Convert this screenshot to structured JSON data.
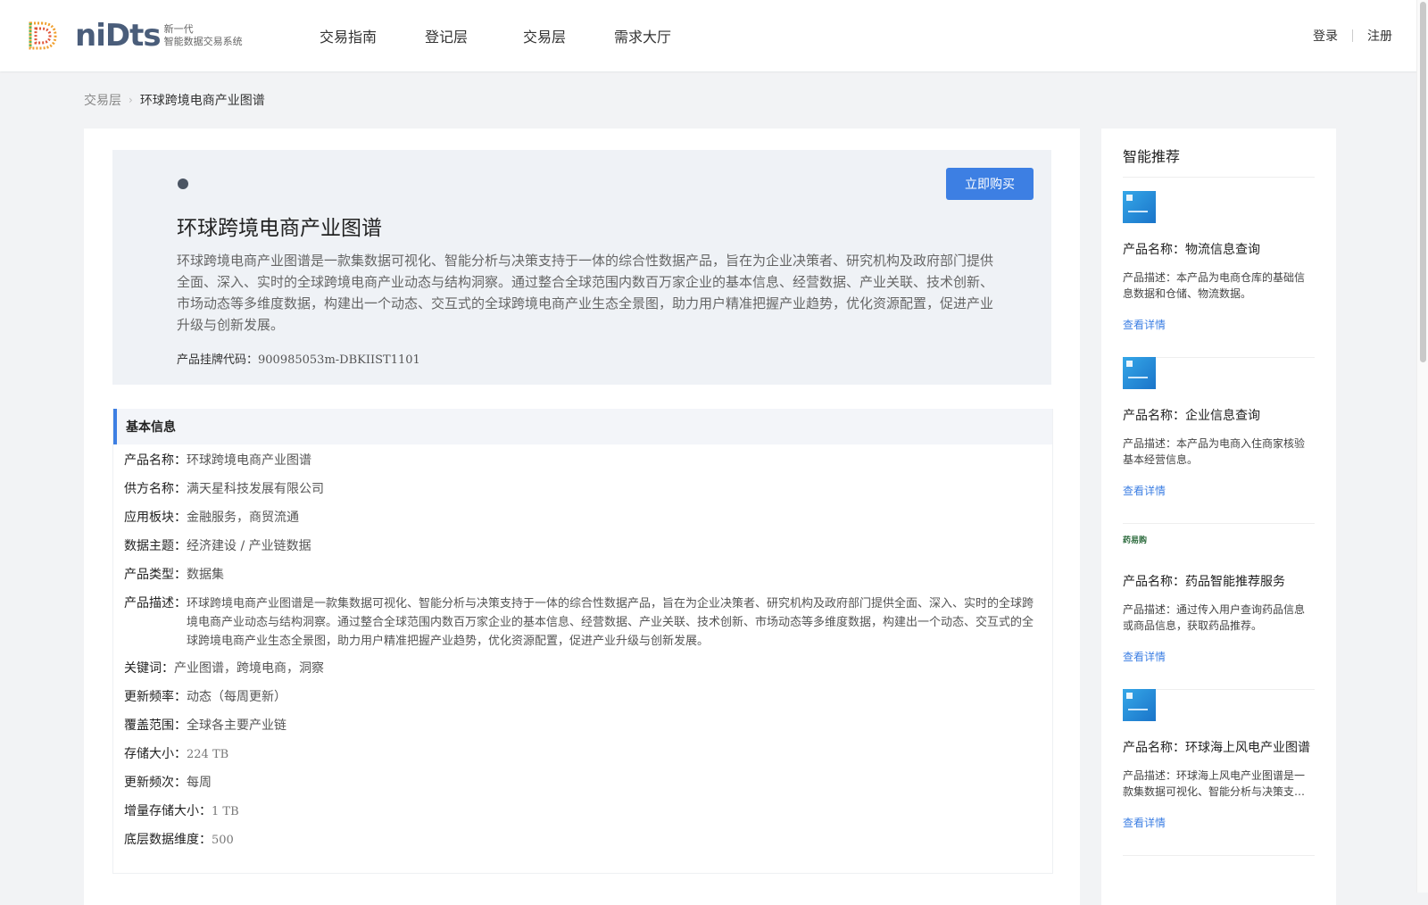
{
  "logo": {
    "word": "niDts",
    "sub_line1": "新一代",
    "sub_line2": "智能数据交易系统"
  },
  "nav": [
    {
      "label": "交易指南"
    },
    {
      "label": "登记层"
    },
    {
      "label": "交易层"
    },
    {
      "label": "需求大厅"
    }
  ],
  "auth": {
    "login": "登录",
    "register": "注册"
  },
  "breadcrumb": {
    "parent": "交易层",
    "current": "环球跨境电商产业图谱"
  },
  "hero": {
    "title": "环球跨境电商产业图谱",
    "description": "环球跨境电商产业图谱是一款集数据可视化、智能分析与决策支持于一体的综合性数据产品，旨在为企业决策者、研究机构及政府部门提供全面、深入、实时的全球跨境电商产业动态与结构洞察。通过整合全球范围内数百万家企业的基本信息、经营数据、产业关联、技术创新、市场动态等多维度数据，构建出一个动态、交互式的全球跨境电商产业生态全景图，助力用户精准把握产业趋势，优化资源配置，促进产业升级与创新发展。",
    "code_label": "产品挂牌代码：",
    "code_value": "900985053m-DBKIIST1101",
    "buy_button": "立即购买"
  },
  "basic_info": {
    "title": "基本信息",
    "rows": [
      {
        "label": "产品名称：",
        "value": "环球跨境电商产业图谱"
      },
      {
        "label": "供方名称：",
        "value": "满天星科技发展有限公司"
      },
      {
        "label": "应用板块：",
        "value": "金融服务，商贸流通"
      },
      {
        "label": "数据主题：",
        "value": "经济建设 / 产业链数据"
      },
      {
        "label": "产品类型：",
        "value": "数据集"
      },
      {
        "label": "产品描述：",
        "value": "环球跨境电商产业图谱是一款集数据可视化、智能分析与决策支持于一体的综合性数据产品，旨在为企业决策者、研究机构及政府部门提供全面、深入、实时的全球跨境电商产业动态与结构洞察。通过整合全球范围内数百万家企业的基本信息、经营数据、产业关联、技术创新、市场动态等多维度数据，构建出一个动态、交互式的全球跨境电商产业生态全景图，助力用户精准把握产业趋势，优化资源配置，促进产业升级与创新发展。"
      },
      {
        "label": "关键词：",
        "value": "产业图谱，跨境电商，洞察"
      },
      {
        "label": "更新频率：",
        "value": "动态（每周更新）"
      },
      {
        "label": "覆盖范围：",
        "value": "全球各主要产业链"
      },
      {
        "label": "存储大小：",
        "value": "224 TB"
      },
      {
        "label": "更新频次：",
        "value": "每周"
      },
      {
        "label": "增量存储大小：",
        "value": "1 TB"
      },
      {
        "label": "底层数据维度：",
        "value": "500"
      }
    ]
  },
  "sidebar": {
    "title": "智能推荐",
    "cards": [
      {
        "name": "产品名称：物流信息查询",
        "desc": "产品描述：本产品为电商仓库的基础信息数据和仓储、物流数据。",
        "link": "查看详情",
        "thumb": "blue-doc-thumbnail"
      },
      {
        "name": "产品名称：企业信息查询",
        "desc": "产品描述：本产品为电商入住商家核验基本经营信息。",
        "link": "查看详情",
        "thumb": "blue-doc-thumbnail"
      },
      {
        "name": "产品名称：药品智能推荐服务",
        "desc": "产品描述：通过传入用户查询药品信息或商品信息，获取药品推荐。",
        "link": "查看详情",
        "thumb": "drug-logo",
        "logo_text": "药易购"
      },
      {
        "name": "产品名称：环球海上风电产业图谱",
        "desc": "产品描述：环球海上风电产业图谱是一款集数据可视化、智能分析与决策支持于一体的综合性数据产品",
        "link": "查看详情",
        "thumb": "blue-doc-thumbnail"
      }
    ]
  },
  "colors": {
    "accent": "#3d7fe3",
    "hero_bg": "#eff2f6",
    "page_bg": "#f2f3f5"
  }
}
